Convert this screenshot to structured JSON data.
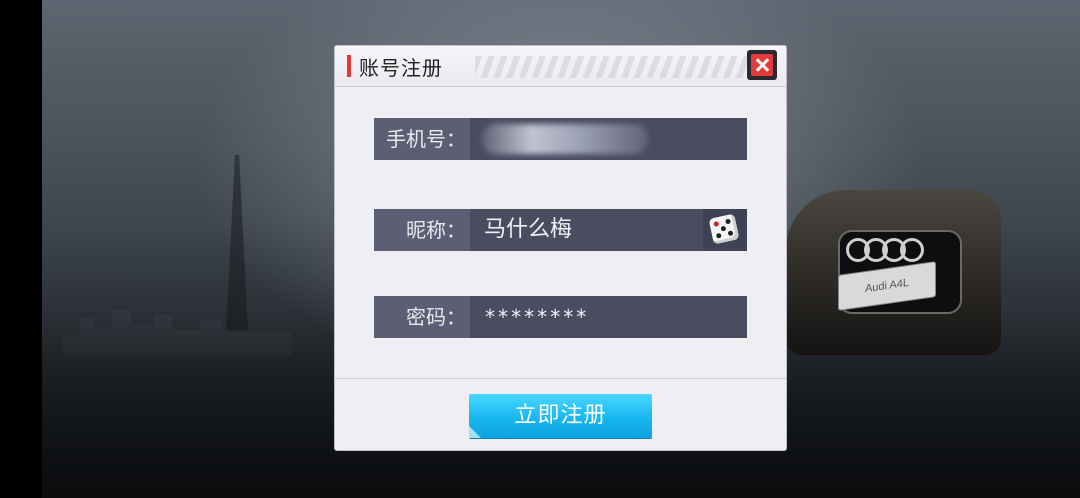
{
  "dialog": {
    "title": "账号注册",
    "close_icon": "close-icon"
  },
  "form": {
    "phone": {
      "label": "手机号：",
      "value_obscured": true
    },
    "nickname": {
      "label": "昵称：",
      "value": "马什么梅",
      "random_icon": "dice-icon"
    },
    "password": {
      "label": "密码：",
      "value": "********"
    }
  },
  "actions": {
    "register_label": "立即注册"
  },
  "background": {
    "plate_text": "Audi A4L"
  },
  "colors": {
    "accent_red": "#e03a3a",
    "field_bg": "#4a4c60",
    "label_bg": "#5c5e73",
    "button_blue": "#18b7f0"
  }
}
